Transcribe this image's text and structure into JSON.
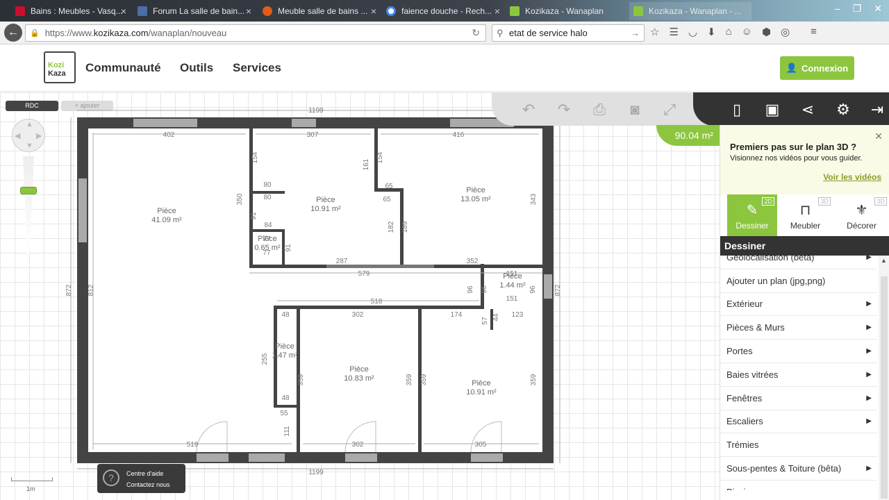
{
  "browser": {
    "tabs": [
      {
        "title": "Bains : Meubles - Vasq...",
        "fav_color": "#c8102e"
      },
      {
        "title": "Forum La salle de bain...",
        "fav_color": "#4a6fa5"
      },
      {
        "title": "Meuble salle de bains ...",
        "fav_color": "#e25c1a"
      },
      {
        "title": "faience douche - Rech...",
        "fav_color": "#4285f4"
      },
      {
        "title": "Kozikaza - Wanaplan",
        "fav_color": "#8cc63f"
      },
      {
        "title": "Kozikaza - Wanaplan - ...",
        "fav_color": "#8cc63f"
      }
    ],
    "url_prefix": "https://www.",
    "url_host": "kozikaza.com",
    "url_path": "/wanaplan/nouveau",
    "search_value": "etat de service halo"
  },
  "site": {
    "logo_line1": "Kozi",
    "logo_line2": "Kaza",
    "nav": [
      "Communauté",
      "Outils",
      "Services"
    ],
    "login_label": "Connexion"
  },
  "editor": {
    "level_tab": "RDC",
    "add_level": "+ ajouter",
    "scale_label": "1m",
    "help_line1": "Centre d'aide",
    "help_line2": "Contactez nous",
    "help_icon": "?",
    "area": "90.04 m²"
  },
  "plan": {
    "rooms": [
      {
        "name": "Pièce",
        "area": "41.09 m²"
      },
      {
        "name": "Pièce",
        "area": "10.91 m²"
      },
      {
        "name": "Pièce",
        "area": "13.05 m²"
      },
      {
        "name": "Pièce",
        "area": "0.65 m²"
      },
      {
        "name": "Pièce",
        "area": "1.44 m²"
      },
      {
        "name": "Pièce",
        "area": "10.83 m²"
      },
      {
        "name": "Pièce",
        "area": "10.91 m²"
      },
      {
        "name": "Pièce",
        "area": "1.47 m²"
      }
    ],
    "dims": [
      "1199",
      "1199",
      "872",
      "872",
      "812",
      "402",
      "307",
      "416",
      "350",
      "343",
      "154",
      "161",
      "154",
      "80",
      "80",
      "65",
      "65",
      "91",
      "84",
      "77",
      "77",
      "91",
      "182",
      "189",
      "287",
      "352",
      "579",
      "151",
      "151",
      "96",
      "96",
      "96",
      "518",
      "302",
      "174",
      "123",
      "48",
      "48",
      "255",
      "57",
      "44",
      "359",
      "359",
      "359",
      "359",
      "55",
      "111",
      "519",
      "302",
      "305"
    ]
  },
  "panel": {
    "promo_title": "Premiers pas sur le plan 3D ?",
    "promo_sub": "Visionnez nos vidéos pour vous guider.",
    "promo_link": "Voir les vidéos",
    "modes": [
      {
        "label": "Dessiner",
        "tag": "2D"
      },
      {
        "label": "Meubler",
        "tag": "3D"
      },
      {
        "label": "Décorer",
        "tag": "3D"
      }
    ],
    "section_title": "Dessiner",
    "menu": [
      {
        "label": "Géolocalisation (bêta)",
        "sub": true
      },
      {
        "label": "Ajouter un plan (jpg,png)",
        "sub": false
      },
      {
        "label": "Extérieur",
        "sub": true
      },
      {
        "label": "Pièces & Murs",
        "sub": true
      },
      {
        "label": "Portes",
        "sub": true
      },
      {
        "label": "Baies vitrées",
        "sub": true
      },
      {
        "label": "Fenêtres",
        "sub": true
      },
      {
        "label": "Escaliers",
        "sub": true
      },
      {
        "label": "Trémies",
        "sub": false
      },
      {
        "label": "Sous-pentes & Toiture (bêta)",
        "sub": true
      },
      {
        "label": "Piscine",
        "sub": false
      }
    ]
  }
}
